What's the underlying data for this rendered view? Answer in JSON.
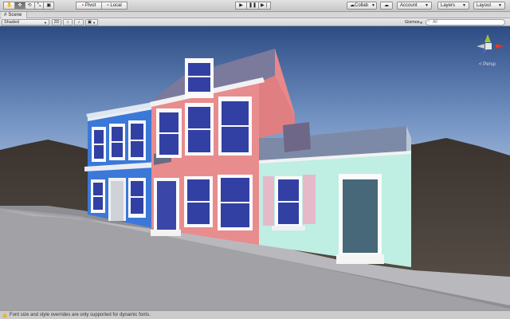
{
  "toolbar": {
    "tools": [
      {
        "name": "hand-tool-icon",
        "glyph": "✋"
      },
      {
        "name": "move-tool-icon",
        "glyph": "✥",
        "active": true
      },
      {
        "name": "rotate-tool-icon",
        "glyph": "⟲"
      },
      {
        "name": "scale-tool-icon",
        "glyph": "⤡"
      },
      {
        "name": "rect-tool-icon",
        "glyph": "▣"
      }
    ],
    "pivot_label": "Pivot",
    "local_label": "Local",
    "collab_label": "Collab",
    "account_label": "Account",
    "layers_label": "Layers",
    "layout_label": "Layout"
  },
  "scene_tab": {
    "label": "Scene"
  },
  "scene_bar": {
    "shading_mode": "Shaded",
    "mode_2d": "2D",
    "gizmos_label": "Gizmos",
    "search_placeholder": "All"
  },
  "viewport": {
    "projection_label": "< Persp",
    "colors": {
      "sky_top": "#2f4f86",
      "sky_bottom": "#9ab6d8",
      "ground": "#4f4741",
      "road": "#9a9aa0",
      "blue_house": "#3b78d8",
      "pink_house": "#e68a8c",
      "mint_house": "#bfeee2",
      "roof": "#7a7a98",
      "window": "#3b47a8"
    }
  },
  "status": {
    "message": "Font size and style overrides are only supported for dynamic fonts."
  }
}
